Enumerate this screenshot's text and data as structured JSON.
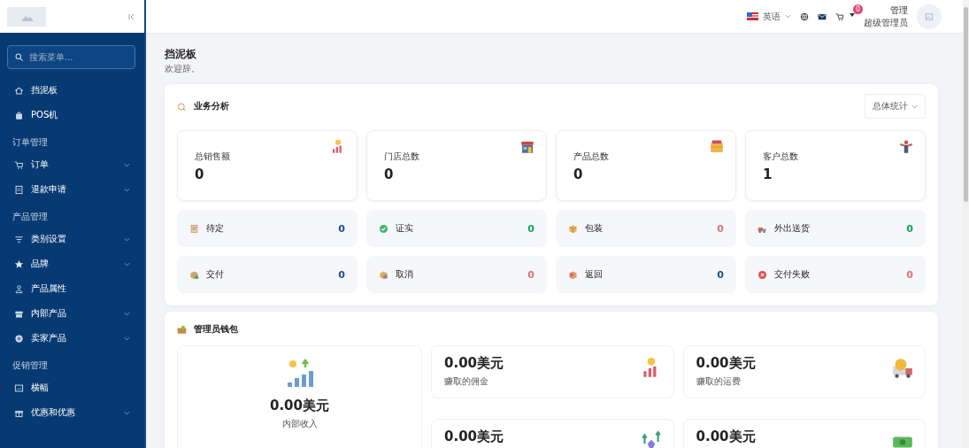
{
  "sidebar": {
    "search": {
      "placeholder": "搜索菜单..."
    },
    "menu": [
      {
        "kind": "item",
        "label": "挡泥板",
        "expandable": false
      },
      {
        "kind": "item",
        "label": "POS机",
        "expandable": false
      },
      {
        "kind": "section",
        "label": "订单管理"
      },
      {
        "kind": "item",
        "label": "订单",
        "expandable": true
      },
      {
        "kind": "item",
        "label": "退款申请",
        "expandable": true
      },
      {
        "kind": "section",
        "label": "产品管理"
      },
      {
        "kind": "item",
        "label": "类别设置",
        "expandable": true
      },
      {
        "kind": "item",
        "label": "品牌",
        "expandable": true
      },
      {
        "kind": "item",
        "label": "产品属性",
        "expandable": false
      },
      {
        "kind": "item",
        "label": "内部产品",
        "expandable": true
      },
      {
        "kind": "item",
        "label": "卖家产品",
        "expandable": true
      },
      {
        "kind": "section",
        "label": "促销管理"
      },
      {
        "kind": "item",
        "label": "横幅",
        "expandable": false
      },
      {
        "kind": "item",
        "label": "优惠和优惠",
        "expandable": true
      }
    ]
  },
  "header": {
    "language": "英语",
    "cart_badge": "0",
    "user": {
      "name": "管理",
      "role": "超级管理员"
    }
  },
  "page": {
    "title": "挡泥板",
    "subtitle": "欢迎辞。"
  },
  "business": {
    "title": "业务分析",
    "filter": "总体统计",
    "stats": [
      {
        "label": "总销售额",
        "value": "0"
      },
      {
        "label": "门店总数",
        "value": "0"
      },
      {
        "label": "产品总数",
        "value": "0"
      },
      {
        "label": "客户总数",
        "value": "1"
      }
    ],
    "statuses": [
      {
        "label": "待定",
        "count": "0",
        "color": "#1d4f91"
      },
      {
        "label": "证实",
        "count": "0",
        "color": "#16a05d"
      },
      {
        "label": "包装",
        "count": "0",
        "color": "#e07474"
      },
      {
        "label": "外出送货",
        "count": "0",
        "color": "#16a05d"
      },
      {
        "label": "交付",
        "count": "0",
        "color": "#1d4f91"
      },
      {
        "label": "取消",
        "count": "0",
        "color": "#e07474"
      },
      {
        "label": "返回",
        "count": "0",
        "color": "#1d4f91"
      },
      {
        "label": "交付失败",
        "count": "0",
        "color": "#e07474"
      }
    ]
  },
  "wallet": {
    "title": "管理员钱包",
    "main": {
      "amount": "0.00美元",
      "label": "内部收入"
    },
    "tiles": [
      {
        "amount": "0.00美元",
        "label": "赚取的佣金"
      },
      {
        "amount": "0.00美元",
        "label": "赚取的运费"
      },
      {
        "amount": "0.00美元"
      },
      {
        "amount": "0.00美元"
      }
    ]
  }
}
